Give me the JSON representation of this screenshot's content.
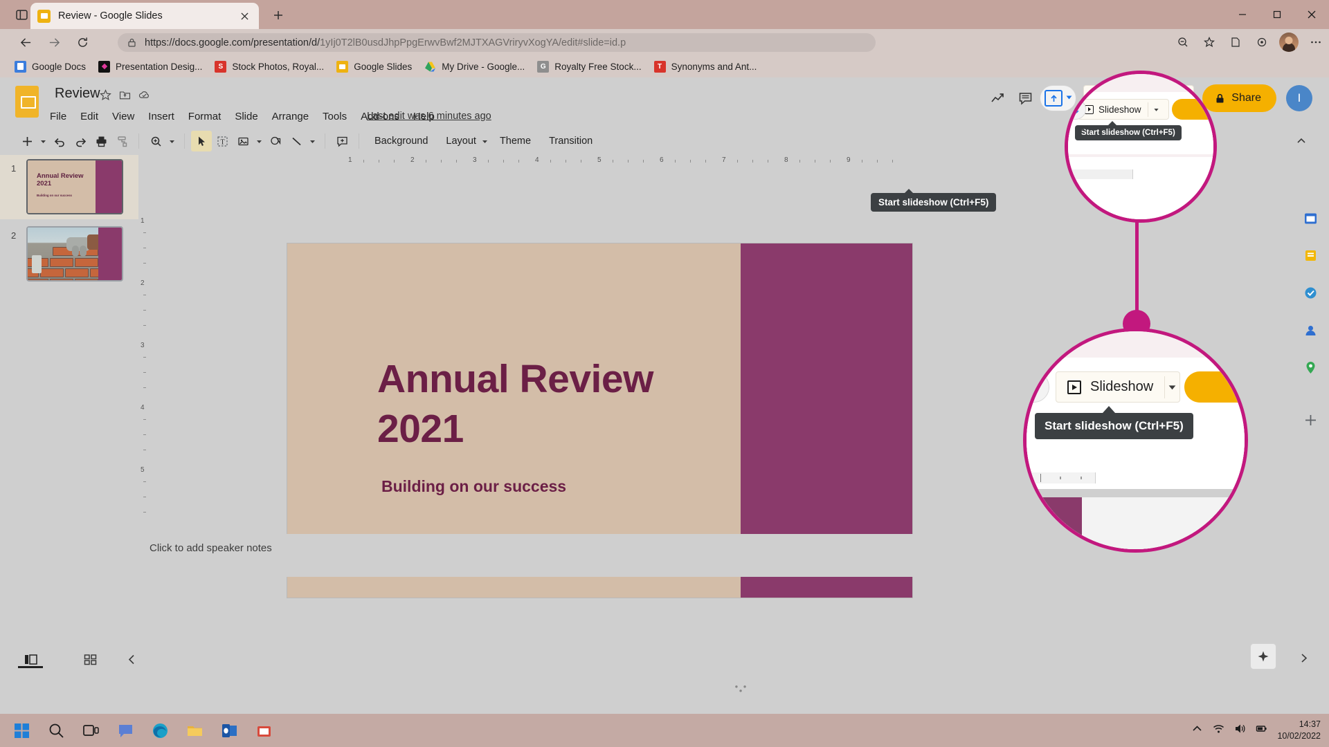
{
  "browser": {
    "tab": {
      "title": "Review - Google Slides",
      "favicon": "slides-favicon"
    },
    "newtab_label": "+",
    "url_protocol": "https://docs.google.com/presentation/d/",
    "url_rest": "1yIj0T2lB0usdJhpPpgErwvBwf2MJTXAGVriryvXogYA/edit#slide=id.p",
    "bookmarks": [
      {
        "label": "Google Docs",
        "icon": "docs-icon",
        "color": "#3b7ddd"
      },
      {
        "label": "Presentation Desig...",
        "icon": "diamond-icon",
        "color": "#111111"
      },
      {
        "label": "Stock Photos, Royal...",
        "icon": "shutterstock-icon",
        "color": "#d8342b"
      },
      {
        "label": "Google Slides",
        "icon": "slides-icon",
        "color": "#eeb211"
      },
      {
        "label": "My Drive - Google...",
        "icon": "drive-icon",
        "color": "#2fa25c"
      },
      {
        "label": "Royalty Free Stock...",
        "icon": "getty-icon",
        "color": "#8e8e8e"
      },
      {
        "label": "Synonyms and Ant...",
        "icon": "thesaurus-icon",
        "color": "#d8342b"
      }
    ]
  },
  "slides_app": {
    "doc_title": "Review",
    "header_icons": [
      "star-icon",
      "move-to-folder-icon",
      "cloud-saved-icon"
    ],
    "menus": [
      "File",
      "Edit",
      "View",
      "Insert",
      "Format",
      "Slide",
      "Arrange",
      "Tools",
      "Add-ons",
      "Help"
    ],
    "last_edit": "Last edit was 6 minutes ago",
    "header_right": {
      "trend_icon": "activity-dashboard-icon",
      "comment_icon": "comment-icon",
      "present_icon": "present-upload-icon",
      "slideshow_label": "Slideshow",
      "share_label": "Share",
      "account_initial": "I"
    },
    "tooltip": "Start slideshow (Ctrl+F5)",
    "toolbar": {
      "new_slide": "add-slide-icon",
      "undo": "undo-icon",
      "redo": "redo-icon",
      "print": "print-icon",
      "paint_format": "paint-format-icon",
      "zoom": "zoom-icon",
      "select": "select-cursor-icon",
      "textbox": "text-box-icon",
      "image": "insert-image-icon",
      "shape": "shape-icon",
      "line": "line-icon",
      "comment": "add-comment-icon",
      "background_label": "Background",
      "layout_label": "Layout",
      "theme_label": "Theme",
      "transition_label": "Transition"
    },
    "filmstrip": [
      {
        "number": "1",
        "title": "Annual Review 2021",
        "subtitle": "Building on our success",
        "selected": true
      },
      {
        "number": "2",
        "title": "",
        "subtitle": "",
        "selected": false
      }
    ],
    "slide": {
      "title_line1": "Annual Review",
      "title_line2": "2021",
      "subtitle": "Building on our success",
      "bg_color": "#d3bda8",
      "band_color": "#8a3a6b",
      "text_color": "#6b1f46"
    },
    "notes_placeholder": "Click to add speaker notes",
    "ruler_marks": [
      "1",
      "2",
      "3",
      "4",
      "5",
      "6",
      "7",
      "8",
      "9"
    ],
    "ruler_marks_v": [
      "1",
      "2",
      "3",
      "4",
      "5"
    ],
    "bottom": {
      "filmstrip_view": "filmstrip-view-icon",
      "grid_view": "grid-view-icon",
      "collapse": "collapse-panel-icon",
      "explore": "explore-icon",
      "expand": "expand-icon"
    },
    "right_rail": [
      "calendar-icon",
      "keep-icon",
      "tasks-icon",
      "contacts-icon",
      "maps-icon",
      "add-on-icon"
    ]
  },
  "callouts": {
    "accent_color": "#c2187e",
    "slideshow_label": "Slideshow",
    "tooltip": "Start slideshow (Ctrl+F5)",
    "share_label": "Share"
  },
  "taskbar": {
    "apps": [
      "start-icon",
      "search-icon",
      "task-view-icon",
      "chat-icon",
      "edge-icon",
      "explorer-icon",
      "outlook-icon",
      "store-icon"
    ],
    "tray": [
      "chevron-up-icon",
      "wifi-icon",
      "volume-icon",
      "battery-icon"
    ],
    "time": "14:37",
    "date": "10/02/2022"
  }
}
